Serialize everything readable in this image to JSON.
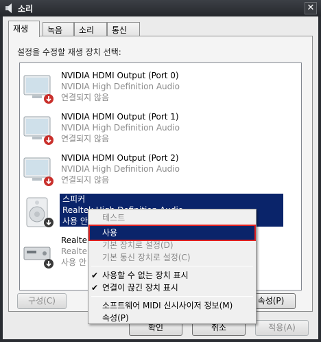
{
  "window": {
    "title": "소리",
    "close_glyph": "✕"
  },
  "tabs": [
    {
      "label": "재생",
      "active": true
    },
    {
      "label": "녹음",
      "active": false
    },
    {
      "label": "소리",
      "active": false
    },
    {
      "label": "통신",
      "active": false
    }
  ],
  "instruction": "설정을 수정할 재생 장치 선택:",
  "devices": [
    {
      "name": "NVIDIA HDMI Output (Port 0)",
      "driver": "NVIDIA High Definition Audio",
      "status": "연결되지 않음",
      "icon": "monitor-icon",
      "state_icon": "disconnected-badge-icon"
    },
    {
      "name": "NVIDIA HDMI Output (Port 1)",
      "driver": "NVIDIA High Definition Audio",
      "status": "연결되지 않음",
      "icon": "monitor-icon",
      "state_icon": "disconnected-badge-icon"
    },
    {
      "name": "NVIDIA HDMI Output (Port 2)",
      "driver": "NVIDIA High Definition Audio",
      "status": "연결되지 않음",
      "icon": "monitor-icon",
      "state_icon": "disconnected-badge-icon"
    },
    {
      "name": "스피커",
      "driver": "Realtek High Definition Audio",
      "status": "사용 안",
      "icon": "speaker-icon",
      "state_icon": "disabled-badge-icon",
      "selected": true
    },
    {
      "name": "Realtek",
      "driver": "Realtek",
      "status": "사용 안",
      "icon": "digital-output-icon",
      "state_icon": "disabled-badge-icon"
    }
  ],
  "buttons": {
    "configure": "구성(C)",
    "properties": "속성(P)",
    "ok": "확인",
    "cancel": "취소",
    "apply": "적용(A)"
  },
  "context_menu": {
    "items": [
      {
        "label": "테스트",
        "disabled": true
      },
      {
        "label": "사용",
        "highlighted": true
      },
      {
        "label": "기본 장치로 설정(D)",
        "disabled": true
      },
      {
        "label": "기본 통신 장치로 설정(C)",
        "disabled": true
      },
      {
        "label": "사용할 수 없는 장치 표시",
        "checked": true
      },
      {
        "label": "연결이 끊긴 장치 표시",
        "checked": true
      },
      {
        "label": "소프트웨어 MIDI 신시사이저 정보(M)"
      },
      {
        "label": "속성(P)"
      }
    ],
    "check_glyph": "✔"
  },
  "colors": {
    "selection": "#0a246a",
    "highlight_outline": "#e02020",
    "disabled_text": "#8a8a8a"
  }
}
